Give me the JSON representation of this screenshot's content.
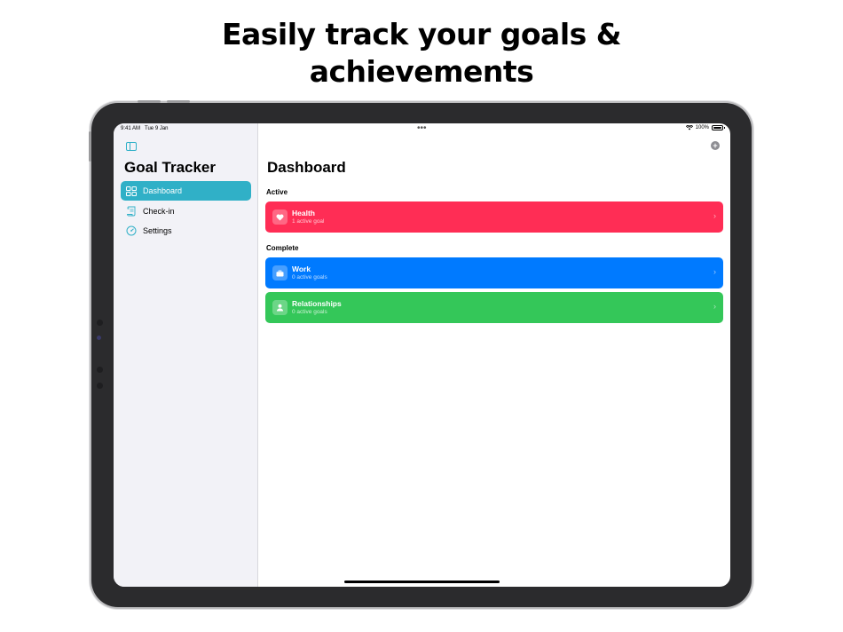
{
  "headline": {
    "line1": "Easily track your goals &",
    "line2": "achievements"
  },
  "status_bar": {
    "time": "9:41 AM",
    "date": "Tue 9 Jan",
    "battery": "100%",
    "battery_level": 1.0
  },
  "sidebar": {
    "title": "Goal Tracker",
    "items": [
      {
        "label": "Dashboard",
        "icon": "grid-icon",
        "selected": true
      },
      {
        "label": "Check-in",
        "icon": "scroll-icon",
        "selected": false
      },
      {
        "label": "Settings",
        "icon": "gauge-icon",
        "selected": false
      }
    ]
  },
  "main": {
    "title": "Dashboard",
    "sections": [
      {
        "label": "Active",
        "cards": [
          {
            "title": "Health",
            "subtitle": "1 active goal",
            "icon": "heart-icon",
            "color": "#ff2d55"
          }
        ]
      },
      {
        "label": "Complete",
        "cards": [
          {
            "title": "Work",
            "subtitle": "0 active goals",
            "icon": "briefcase-icon",
            "color": "#007aff"
          },
          {
            "title": "Relationships",
            "subtitle": "0 active goals",
            "icon": "person-icon",
            "color": "#34c759"
          }
        ]
      }
    ]
  },
  "colors": {
    "accent": "#30b0c7",
    "sidebar_bg": "#f2f2f7"
  }
}
